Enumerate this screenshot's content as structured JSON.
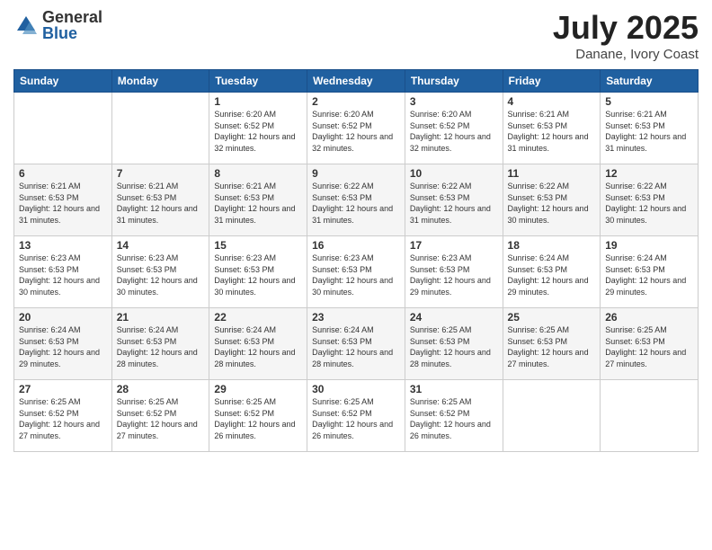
{
  "header": {
    "logo_general": "General",
    "logo_blue": "Blue",
    "title": "July 2025",
    "subtitle": "Danane, Ivory Coast"
  },
  "days_of_week": [
    "Sunday",
    "Monday",
    "Tuesday",
    "Wednesday",
    "Thursday",
    "Friday",
    "Saturday"
  ],
  "weeks": [
    [
      {
        "day": "",
        "info": ""
      },
      {
        "day": "",
        "info": ""
      },
      {
        "day": "1",
        "info": "Sunrise: 6:20 AM\nSunset: 6:52 PM\nDaylight: 12 hours and 32 minutes."
      },
      {
        "day": "2",
        "info": "Sunrise: 6:20 AM\nSunset: 6:52 PM\nDaylight: 12 hours and 32 minutes."
      },
      {
        "day": "3",
        "info": "Sunrise: 6:20 AM\nSunset: 6:52 PM\nDaylight: 12 hours and 32 minutes."
      },
      {
        "day": "4",
        "info": "Sunrise: 6:21 AM\nSunset: 6:53 PM\nDaylight: 12 hours and 31 minutes."
      },
      {
        "day": "5",
        "info": "Sunrise: 6:21 AM\nSunset: 6:53 PM\nDaylight: 12 hours and 31 minutes."
      }
    ],
    [
      {
        "day": "6",
        "info": "Sunrise: 6:21 AM\nSunset: 6:53 PM\nDaylight: 12 hours and 31 minutes."
      },
      {
        "day": "7",
        "info": "Sunrise: 6:21 AM\nSunset: 6:53 PM\nDaylight: 12 hours and 31 minutes."
      },
      {
        "day": "8",
        "info": "Sunrise: 6:21 AM\nSunset: 6:53 PM\nDaylight: 12 hours and 31 minutes."
      },
      {
        "day": "9",
        "info": "Sunrise: 6:22 AM\nSunset: 6:53 PM\nDaylight: 12 hours and 31 minutes."
      },
      {
        "day": "10",
        "info": "Sunrise: 6:22 AM\nSunset: 6:53 PM\nDaylight: 12 hours and 31 minutes."
      },
      {
        "day": "11",
        "info": "Sunrise: 6:22 AM\nSunset: 6:53 PM\nDaylight: 12 hours and 30 minutes."
      },
      {
        "day": "12",
        "info": "Sunrise: 6:22 AM\nSunset: 6:53 PM\nDaylight: 12 hours and 30 minutes."
      }
    ],
    [
      {
        "day": "13",
        "info": "Sunrise: 6:23 AM\nSunset: 6:53 PM\nDaylight: 12 hours and 30 minutes."
      },
      {
        "day": "14",
        "info": "Sunrise: 6:23 AM\nSunset: 6:53 PM\nDaylight: 12 hours and 30 minutes."
      },
      {
        "day": "15",
        "info": "Sunrise: 6:23 AM\nSunset: 6:53 PM\nDaylight: 12 hours and 30 minutes."
      },
      {
        "day": "16",
        "info": "Sunrise: 6:23 AM\nSunset: 6:53 PM\nDaylight: 12 hours and 30 minutes."
      },
      {
        "day": "17",
        "info": "Sunrise: 6:23 AM\nSunset: 6:53 PM\nDaylight: 12 hours and 29 minutes."
      },
      {
        "day": "18",
        "info": "Sunrise: 6:24 AM\nSunset: 6:53 PM\nDaylight: 12 hours and 29 minutes."
      },
      {
        "day": "19",
        "info": "Sunrise: 6:24 AM\nSunset: 6:53 PM\nDaylight: 12 hours and 29 minutes."
      }
    ],
    [
      {
        "day": "20",
        "info": "Sunrise: 6:24 AM\nSunset: 6:53 PM\nDaylight: 12 hours and 29 minutes."
      },
      {
        "day": "21",
        "info": "Sunrise: 6:24 AM\nSunset: 6:53 PM\nDaylight: 12 hours and 28 minutes."
      },
      {
        "day": "22",
        "info": "Sunrise: 6:24 AM\nSunset: 6:53 PM\nDaylight: 12 hours and 28 minutes."
      },
      {
        "day": "23",
        "info": "Sunrise: 6:24 AM\nSunset: 6:53 PM\nDaylight: 12 hours and 28 minutes."
      },
      {
        "day": "24",
        "info": "Sunrise: 6:25 AM\nSunset: 6:53 PM\nDaylight: 12 hours and 28 minutes."
      },
      {
        "day": "25",
        "info": "Sunrise: 6:25 AM\nSunset: 6:53 PM\nDaylight: 12 hours and 27 minutes."
      },
      {
        "day": "26",
        "info": "Sunrise: 6:25 AM\nSunset: 6:53 PM\nDaylight: 12 hours and 27 minutes."
      }
    ],
    [
      {
        "day": "27",
        "info": "Sunrise: 6:25 AM\nSunset: 6:52 PM\nDaylight: 12 hours and 27 minutes."
      },
      {
        "day": "28",
        "info": "Sunrise: 6:25 AM\nSunset: 6:52 PM\nDaylight: 12 hours and 27 minutes."
      },
      {
        "day": "29",
        "info": "Sunrise: 6:25 AM\nSunset: 6:52 PM\nDaylight: 12 hours and 26 minutes."
      },
      {
        "day": "30",
        "info": "Sunrise: 6:25 AM\nSunset: 6:52 PM\nDaylight: 12 hours and 26 minutes."
      },
      {
        "day": "31",
        "info": "Sunrise: 6:25 AM\nSunset: 6:52 PM\nDaylight: 12 hours and 26 minutes."
      },
      {
        "day": "",
        "info": ""
      },
      {
        "day": "",
        "info": ""
      }
    ]
  ]
}
